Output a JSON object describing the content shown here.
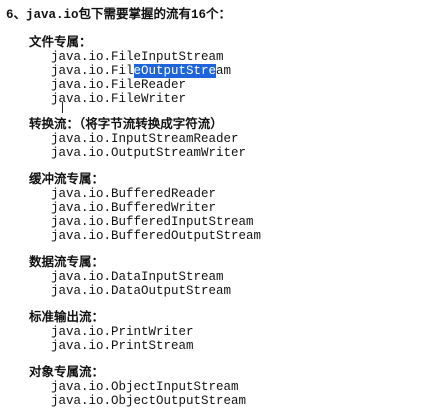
{
  "heading": "6、java.io包下需要掌握的流有16个：",
  "sections": [
    {
      "title": "文件专属：",
      "items": [
        "java.io.FileInputStream",
        "java.io.FileOutputStream",
        "java.io.FileReader",
        "java.io.FileWriter"
      ]
    },
    {
      "title": "转换流：（将字节流转换成字符流）",
      "items": [
        "java.io.InputStreamReader",
        "java.io.OutputStreamWriter"
      ]
    },
    {
      "title": "缓冲流专属：",
      "items": [
        "java.io.BufferedReader",
        "java.io.BufferedWriter",
        "java.io.BufferedInputStream",
        "java.io.BufferedOutputStream"
      ]
    },
    {
      "title": "数据流专属：",
      "items": [
        "java.io.DataInputStream",
        "java.io.DataOutputStream"
      ]
    },
    {
      "title": "标准输出流：",
      "items": [
        "java.io.PrintWriter",
        "java.io.PrintStream"
      ]
    },
    {
      "title": "对象专属流：",
      "items": [
        "java.io.ObjectInputStream",
        "java.io.ObjectOutputStream"
      ]
    }
  ],
  "selection": {
    "before": "java.io.Fil",
    "selected": "eOutputStre",
    "after": "am"
  }
}
